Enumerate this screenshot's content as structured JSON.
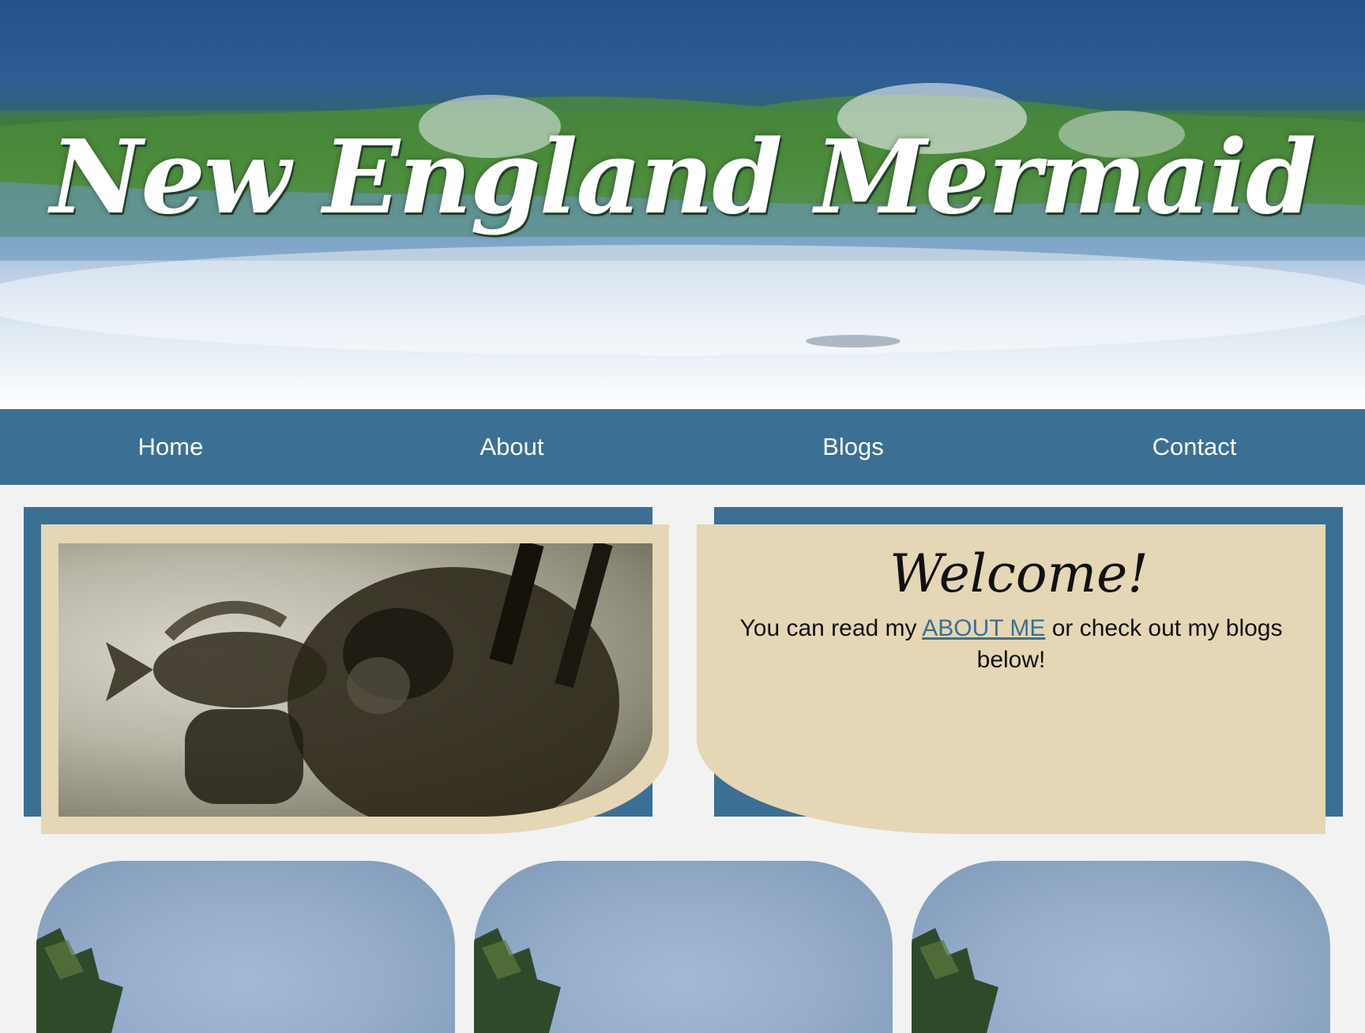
{
  "site": {
    "title": "New England Mermaid"
  },
  "nav": {
    "items": [
      {
        "label": "Home"
      },
      {
        "label": "About"
      },
      {
        "label": "Blogs"
      },
      {
        "label": "Contact"
      }
    ]
  },
  "welcome": {
    "heading": "Welcome!",
    "text_before": "You can read my ",
    "link": "ABOUT ME",
    "text_after": " or check out my blogs below!"
  },
  "colors": {
    "nav": "#3b7094",
    "card": "#e5d6b5",
    "link": "#3b7094",
    "page_bg": "#f2f2f2"
  }
}
